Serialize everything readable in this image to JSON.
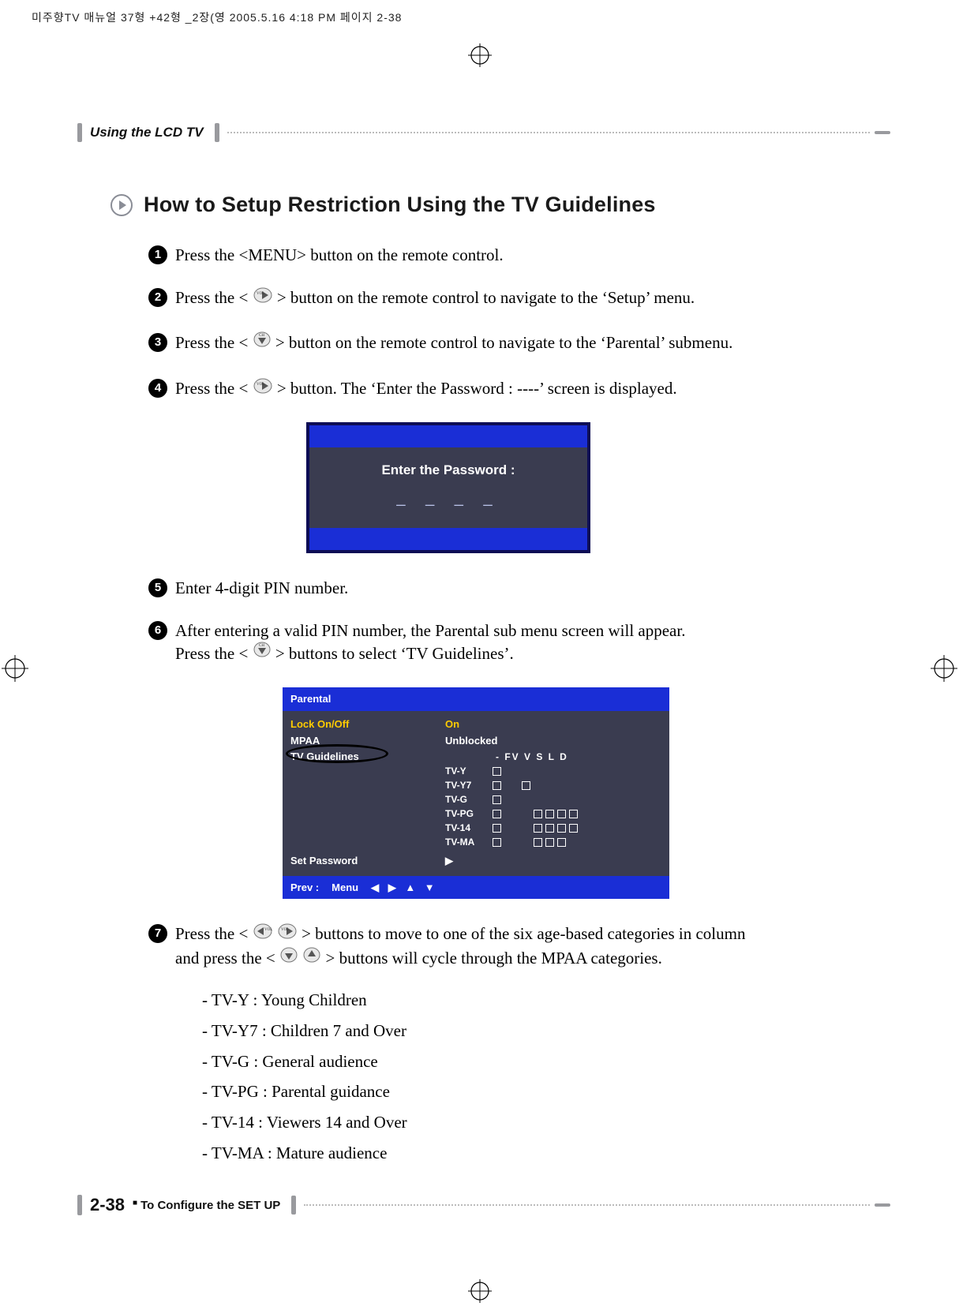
{
  "print_mark": "미주향TV 매뉴얼 37형 +42형 _2장(영  2005.5.16  4:18 PM  페이지 2-38",
  "header": {
    "section": "Using the LCD TV"
  },
  "title": "How to Setup Restriction Using the TV Guidelines",
  "steps": {
    "s1": "Press the <MENU> button on the remote control.",
    "s2a": "Press the <",
    "s2b": "> button on the remote control to navigate to the ‘Setup’ menu.",
    "s3a": "Press the <",
    "s3b": "> button on the remote control to navigate to the ‘Parental’ submenu.",
    "s4a": "Press the <",
    "s4b": "> button. The ‘Enter the Password : ----’ screen is displayed.",
    "s5": "Enter 4-digit PIN number.",
    "s6a": "After entering a valid PIN number, the Parental sub menu screen will appear.",
    "s6b": "Press the <",
    "s6c": "> buttons to select ‘TV Guidelines’.",
    "s7a": "Press the <",
    "s7b": "> buttons to move to one of the six age-based categories in column",
    "s7c": "and press the <",
    "s7d": "> buttons will cycle through the MPAA categories."
  },
  "screen1": {
    "label": "Enter the Password :",
    "dashes": "_  _  _  _"
  },
  "screen2": {
    "title": "Parental",
    "lock": "Lock On/Off",
    "mpaa": "MPAA",
    "tvg": "TV Guidelines",
    "setpw": "Set Password",
    "on": "On",
    "unblocked": "Unblocked",
    "headers": "- FV  V  S  L  D",
    "rows": [
      {
        "label": "TV-Y",
        "boxes": [
          1,
          0,
          0,
          0,
          0,
          0
        ]
      },
      {
        "label": "TV-Y7",
        "boxes": [
          1,
          1,
          0,
          0,
          0,
          0
        ]
      },
      {
        "label": "TV-G",
        "boxes": [
          1,
          0,
          0,
          0,
          0,
          0
        ]
      },
      {
        "label": "TV-PG",
        "boxes": [
          1,
          0,
          1,
          1,
          1,
          1
        ]
      },
      {
        "label": "TV-14",
        "boxes": [
          1,
          0,
          1,
          1,
          1,
          1
        ]
      },
      {
        "label": "TV-MA",
        "boxes": [
          1,
          0,
          1,
          1,
          1,
          0
        ]
      }
    ],
    "prev": "Prev :",
    "menu": "Menu",
    "arrows": "◀ ▶ ▲ ▼",
    "play": "▶"
  },
  "ratings": {
    "y": "- TV-Y : Young Children",
    "y7": "- TV-Y7 : Children 7 and Over",
    "g": "- TV-G : General audience",
    "pg": "- TV-PG : Parental guidance",
    "14": "- TV-14 : Viewers 14 and Over",
    "ma": "- TV-MA : Mature audience"
  },
  "footer": {
    "page": "2-38",
    "sq": "■",
    "sub": "To Configure the SET UP"
  },
  "icons": {
    "vol_right": "VOL▶",
    "ch_down": "CH▼",
    "vol_left": "VOL◀"
  }
}
